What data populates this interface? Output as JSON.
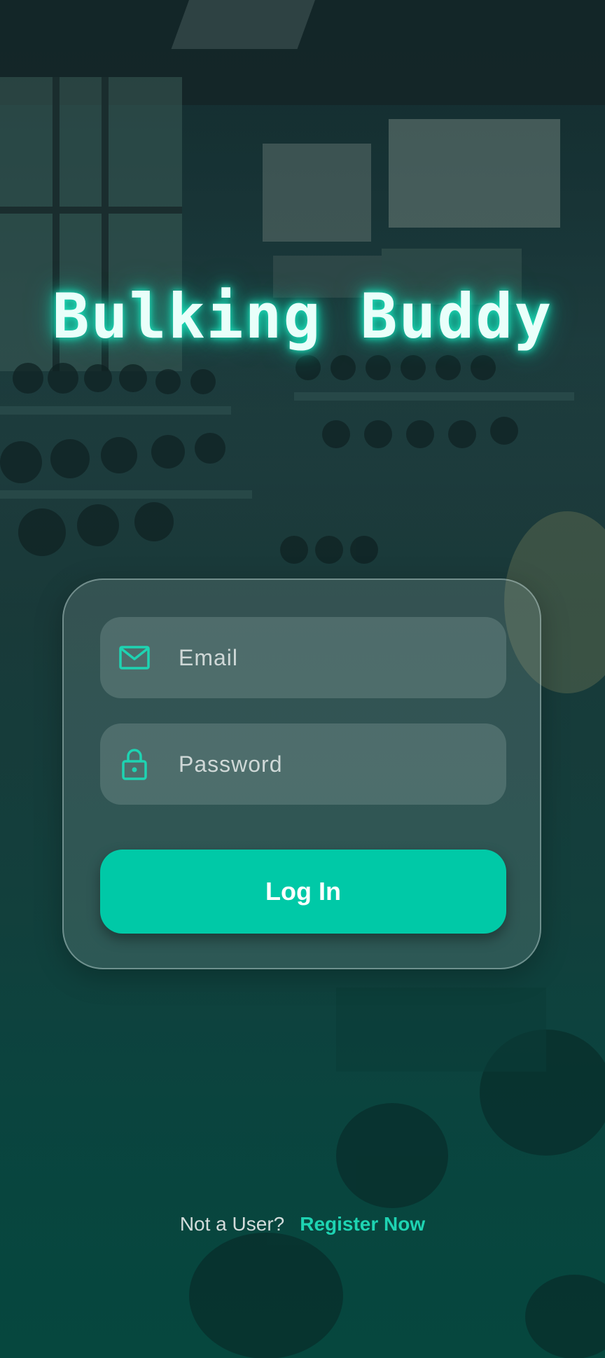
{
  "app": {
    "title": "Bulking Buddy"
  },
  "form": {
    "email": {
      "placeholder": "Email",
      "value": "",
      "icon": "envelope-icon"
    },
    "password": {
      "placeholder": "Password",
      "value": "",
      "icon": "lock-icon"
    },
    "login_label": "Log In"
  },
  "footer": {
    "prompt": "Not a User?",
    "register_label": "Register Now"
  },
  "colors": {
    "accent": "#00c9a7",
    "title_glow": "#1ee6c0",
    "link": "#1ed3b2"
  }
}
